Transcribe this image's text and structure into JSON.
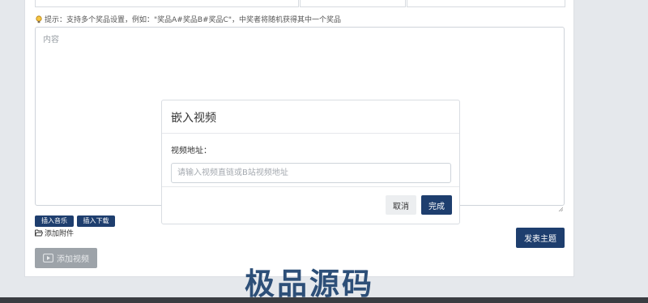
{
  "tip": {
    "text": "提示：支持多个奖品设置，例如：\"奖品A#奖品B#奖品C\"，中奖者将随机获得其中一个奖品"
  },
  "editor": {
    "placeholder": "内容"
  },
  "modal": {
    "title": "嵌入视频",
    "field_label": "视频地址：",
    "input_placeholder": "请输入视频直链或B站视频地址",
    "input_value": "",
    "cancel_label": "取消",
    "done_label": "完成"
  },
  "toolbar": {
    "insert_music": "插入音乐",
    "insert_download": "插入下载"
  },
  "attach": {
    "label": "添加附件"
  },
  "add_video": {
    "label": "添加视频"
  },
  "publish": {
    "label": "发表主题"
  },
  "watermark": {
    "text": "极品源码"
  },
  "colors": {
    "primary": "#1e3e6e",
    "disabled": "#9da3a9",
    "background": "#e5e8ec",
    "tip_bulb": "#e8a317"
  },
  "icons": {
    "tip": "lightbulb-icon",
    "attach": "folder-open-icon",
    "video": "play-icon"
  }
}
